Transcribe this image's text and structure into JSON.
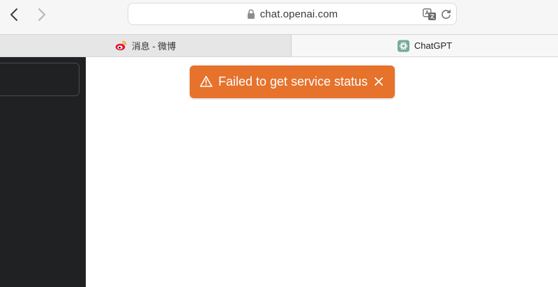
{
  "browser": {
    "url": "chat.openai.com",
    "tabs": [
      {
        "title": "消息 - 微博",
        "favicon": "weibo-icon",
        "active": false
      },
      {
        "title": "ChatGPT",
        "favicon": "chatgpt-icon",
        "active": true
      }
    ]
  },
  "toast": {
    "message": "Failed to get service status",
    "icon": "warning-icon",
    "color": "#e6722c"
  },
  "colors": {
    "sidebar": "#202123",
    "main": "#ffffff"
  }
}
